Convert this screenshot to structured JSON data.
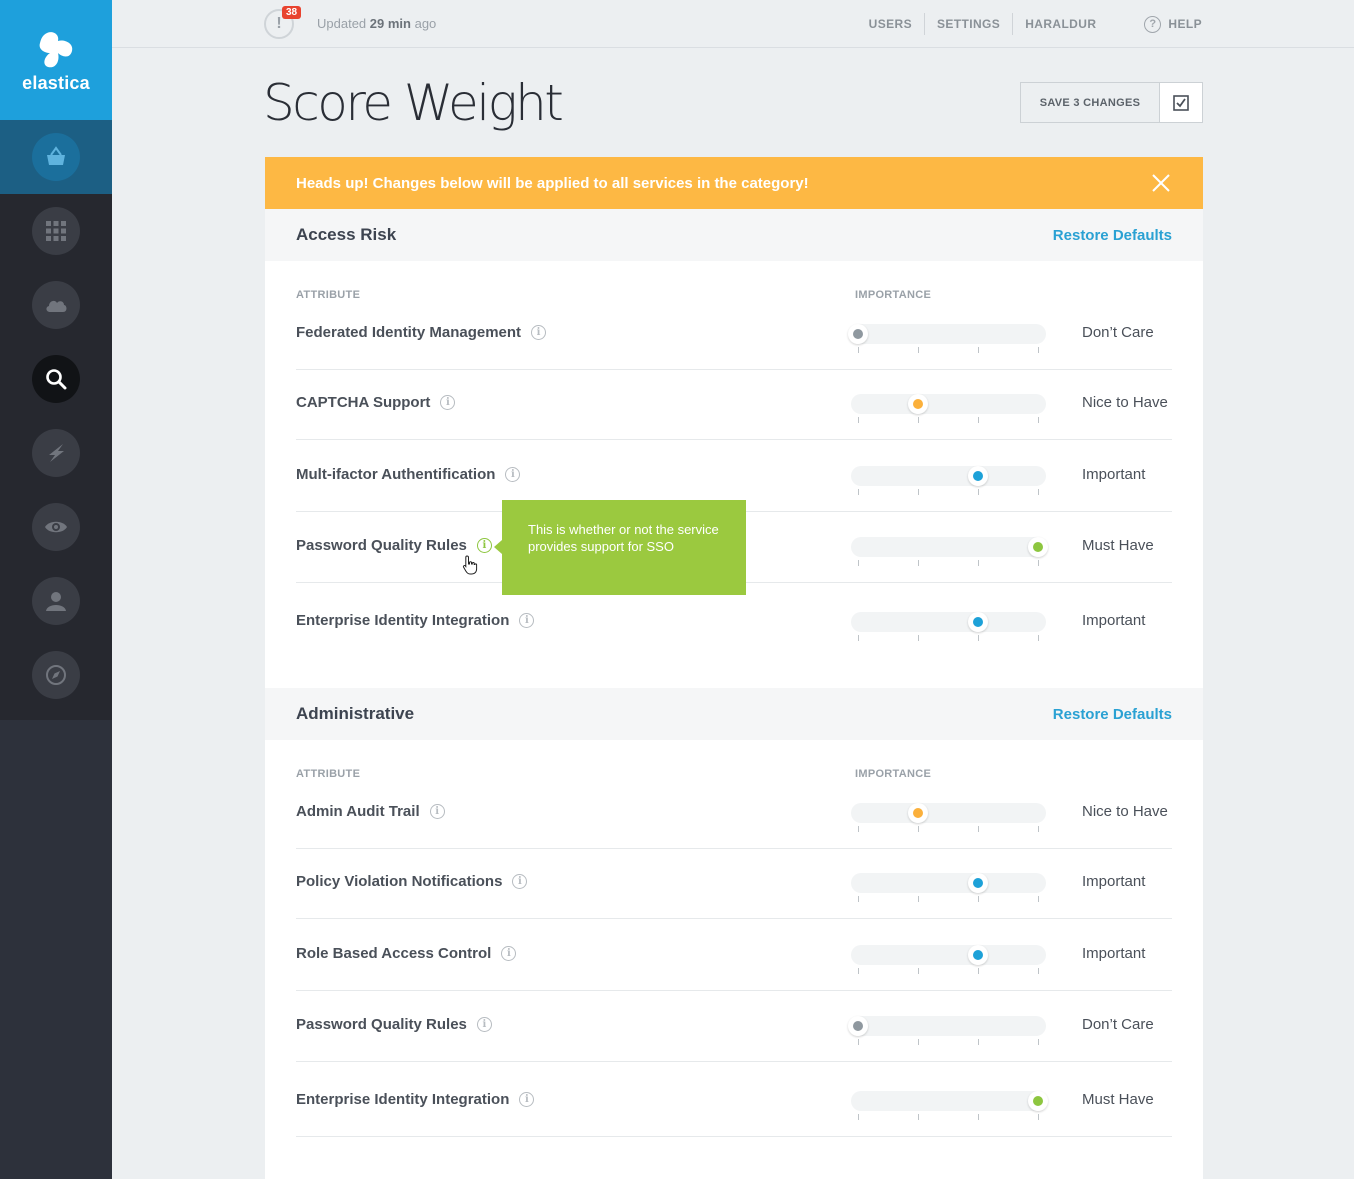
{
  "brand": {
    "name": "elastica",
    "color": "#1ea0dc"
  },
  "sidebar": {
    "items": [
      {
        "icon": "basket-icon",
        "active": true
      },
      {
        "icon": "grid-icon"
      },
      {
        "icon": "cloud-icon"
      },
      {
        "icon": "search-icon",
        "selected": true
      },
      {
        "icon": "bolt-icon"
      },
      {
        "icon": "eye-icon"
      },
      {
        "icon": "user-icon"
      },
      {
        "icon": "compass-icon"
      }
    ]
  },
  "topbar": {
    "alert_count": "38",
    "alert_symbol": "!",
    "updated_prefix": "Updated",
    "updated_time": "29 min",
    "updated_suffix": "ago",
    "nav": [
      "USERS",
      "SETTINGS",
      "HARALDUR"
    ],
    "help_label": "HELP",
    "help_symbol": "?"
  },
  "page": {
    "title": "Score Weight",
    "save_label": "SAVE 3 CHANGES"
  },
  "banner": {
    "text": "Heads up! Changes below will be applied to all services in the category!",
    "color": "#fdb844"
  },
  "levels_colors": {
    "Don’t Care": "#8f989f",
    "Nice to Have": "#fbb03b",
    "Important": "#1da1d8",
    "Must Have": "#8dc63f"
  },
  "tooltip": {
    "text": "This is whether or not the service provides support for SSO"
  },
  "sections": [
    {
      "title": "Access Risk",
      "restore_label": "Restore Defaults",
      "attribute_header": "ATTRIBUTE",
      "importance_header": "IMPORTANCE",
      "rows": [
        {
          "label": "Federated Identity Management",
          "level": "Don’t Care",
          "value": 0
        },
        {
          "label": "CAPTCHA Support",
          "level": "Nice to Have",
          "value": 1
        },
        {
          "label": "Mult-ifactor Authentification",
          "level": "Important",
          "value": 2
        },
        {
          "label": "Password Quality Rules",
          "level": "Must Have",
          "value": 3
        },
        {
          "label": "Enterprise Identity Integration",
          "level": "Important",
          "value": 2
        }
      ]
    },
    {
      "title": "Administrative",
      "restore_label": "Restore Defaults",
      "attribute_header": "ATTRIBUTE",
      "importance_header": "IMPORTANCE",
      "rows": [
        {
          "label": "Admin Audit Trail",
          "level": "Nice to Have",
          "value": 1
        },
        {
          "label": "Policy Violation Notifications",
          "level": "Important",
          "value": 2
        },
        {
          "label": "Role Based Access Control",
          "level": "Important",
          "value": 2
        },
        {
          "label": "Password Quality Rules",
          "level": "Don’t Care",
          "value": 0
        },
        {
          "label": "Enterprise Identity Integration",
          "level": "Must Have",
          "value": 3
        }
      ]
    }
  ]
}
